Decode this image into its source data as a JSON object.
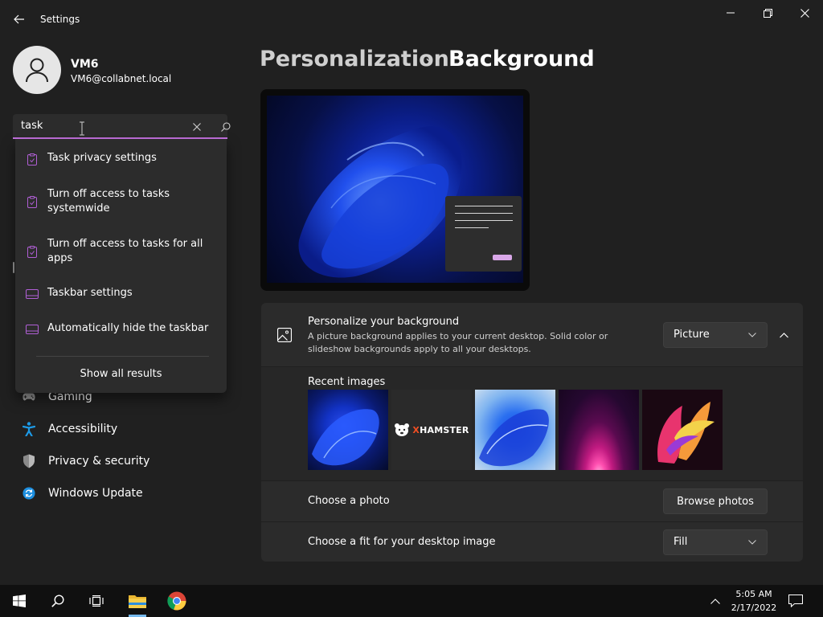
{
  "window": {
    "title": "Settings",
    "controls": {
      "minimize": "minimize-icon",
      "maximize": "restore-icon",
      "close": "close-icon"
    }
  },
  "profile": {
    "name": "VM6",
    "email": "VM6@collabnet.local"
  },
  "search": {
    "value": "task",
    "clear_icon": "close-icon",
    "go_icon": "search-icon",
    "results": [
      {
        "label": "Task privacy settings",
        "icon": "clipboard-icon"
      },
      {
        "label": "Turn off access to tasks systemwide",
        "icon": "clipboard-icon"
      },
      {
        "label": "Turn off access to tasks for all apps",
        "icon": "clipboard-icon"
      },
      {
        "label": "Taskbar settings",
        "icon": "taskbar-icon"
      },
      {
        "label": "Automatically hide the taskbar",
        "icon": "taskbar-icon"
      }
    ],
    "show_all": "Show all results"
  },
  "nav": [
    {
      "label": "Gaming",
      "icon": "gamepad-icon"
    },
    {
      "label": "Accessibility",
      "icon": "accessibility-icon"
    },
    {
      "label": "Privacy & security",
      "icon": "shield-icon"
    },
    {
      "label": "Windows Update",
      "icon": "update-icon"
    }
  ],
  "breadcrumb": {
    "parent": "Personalization",
    "separator": "›",
    "current": "Background"
  },
  "background": {
    "title": "Personalize your background",
    "description": "A picture background applies to your current desktop. Solid color or slideshow backgrounds apply to all your desktops.",
    "type_value": "Picture",
    "recent_title": "Recent images",
    "recent_images": [
      "bloom-blue-dark",
      "xhamster-logo",
      "bloom-blue-light",
      "purple-glow",
      "abstract-flower"
    ],
    "brand_text_x": "X",
    "brand_text_rest": "HAMSTER",
    "choose_photo_label": "Choose a photo",
    "browse_label": "Browse photos",
    "fit_label": "Choose a fit for your desktop image",
    "fit_value": "Fill"
  },
  "taskbar": {
    "time": "5:05 AM",
    "date": "2/17/2022",
    "icons": [
      "windows-start-icon",
      "search-icon",
      "task-view-icon",
      "file-explorer-icon",
      "chrome-icon"
    ]
  },
  "colors": {
    "accent": "#c471e0",
    "background": "#202020",
    "card": "#2b2b2b",
    "taskbar": "#101010"
  }
}
